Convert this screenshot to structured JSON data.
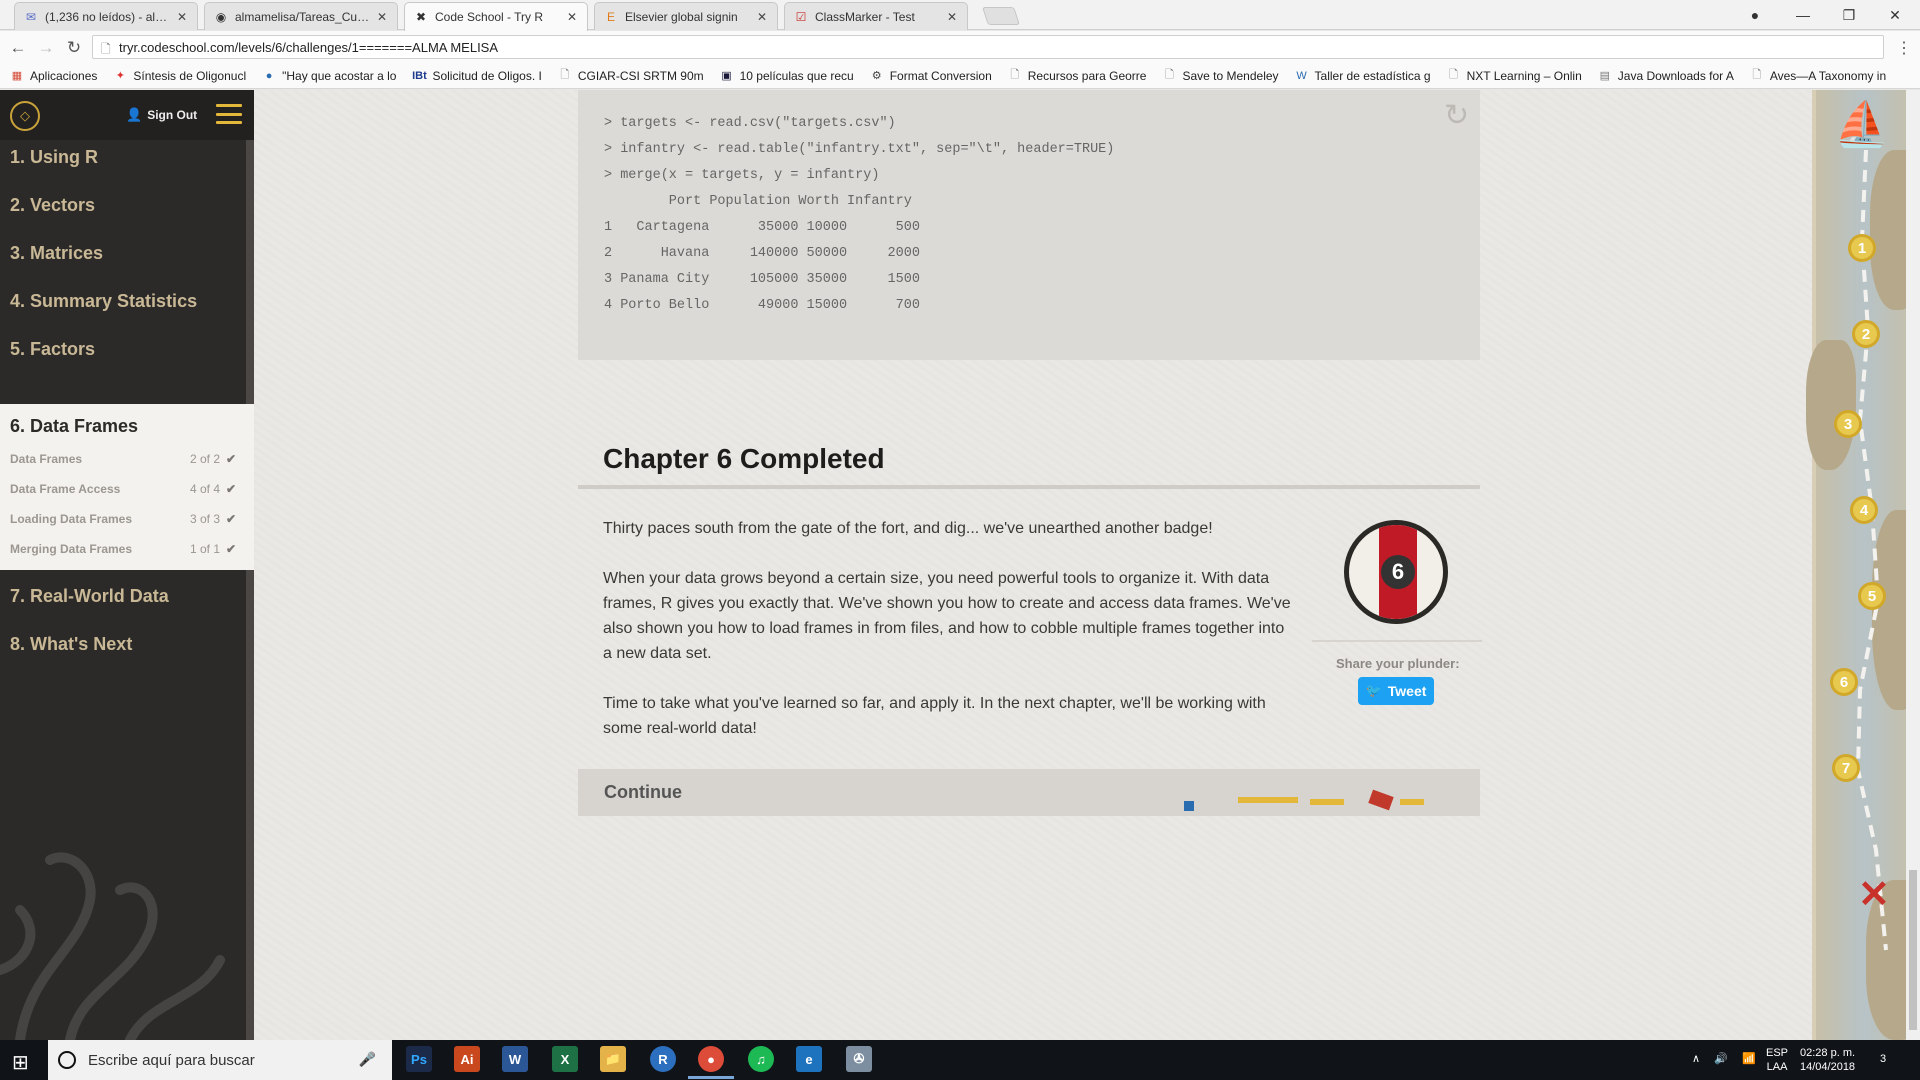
{
  "browser": {
    "tabs": [
      {
        "title": "(1,236 no leídos) - alma",
        "icon": "mail-icon",
        "color": "#5a6ec8"
      },
      {
        "title": "almamelisa/Tareas_Curso",
        "icon": "github-icon",
        "color": "#222222"
      },
      {
        "title": "Code School - Try R",
        "icon": "codeschool-icon",
        "color": "#333333"
      },
      {
        "title": "Elsevier global signin",
        "icon": "elsevier-icon",
        "color": "#e07b1a"
      },
      {
        "title": "ClassMarker - Test",
        "icon": "classmarker-icon",
        "color": "#c8322b"
      }
    ],
    "url": "tryr.codeschool.com/levels/6/challenges/1=======ALMA MELISA",
    "bookmarks": [
      {
        "label": "Aplicaciones",
        "icon": "apps-grid-icon"
      },
      {
        "label": "Síntesis de Oligonucl",
        "icon": "flame-icon"
      },
      {
        "label": "\"Hay que acostar a lo",
        "icon": "globe-icon"
      },
      {
        "label": "Solicitud de Oligos. I",
        "icon": "ibt-icon"
      },
      {
        "label": "CGIAR-CSI SRTM 90m",
        "icon": "page-icon"
      },
      {
        "label": "10 películas que recu",
        "icon": "film-icon"
      },
      {
        "label": "Format Conversion",
        "icon": "gear-icon"
      },
      {
        "label": "Recursos para Georre",
        "icon": "page-icon"
      },
      {
        "label": "Save to Mendeley",
        "icon": "page-icon"
      },
      {
        "label": "Taller de estadística g",
        "icon": "w-icon"
      },
      {
        "label": "NXT Learning – Onlin",
        "icon": "page-icon"
      },
      {
        "label": "Java Downloads for A",
        "icon": "java-icon"
      },
      {
        "label": "Aves—A Taxonomy in",
        "icon": "page-icon"
      }
    ]
  },
  "sidebar": {
    "signout": "Sign Out",
    "chapters": [
      "1. Using R",
      "2. Vectors",
      "3. Matrices",
      "4. Summary Statistics",
      "5. Factors",
      "6. Data Frames",
      "7. Real-World Data",
      "8. What's Next"
    ],
    "lessons": [
      {
        "label": "Data Frames",
        "count": "2 of 2"
      },
      {
        "label": "Data Frame Access",
        "count": "4 of 4"
      },
      {
        "label": "Loading Data Frames",
        "count": "3 of 3"
      },
      {
        "label": "Merging Data Frames",
        "count": "1 of 1"
      }
    ]
  },
  "code": [
    "> targets <- read.csv(\"targets.csv\")",
    "> infantry <- read.table(\"infantry.txt\", sep=\"\\t\", header=TRUE)",
    "> merge(x = targets, y = infantry)",
    "        Port Population Worth Infantry",
    "1   Cartagena      35000 10000      500",
    "2      Havana     140000 50000     2000",
    "3 Panama City     105000 35000     1500",
    "4 Porto Bello      49000 15000      700"
  ],
  "completion": {
    "heading": "Chapter 6 Completed",
    "paragraphs": [
      "Thirty paces south from the gate of the fort, and dig... we've unearthed another badge!",
      "When your data grows beyond a certain size, you need powerful tools to organize it. With data frames, R gives you exactly that. We've shown you how to create and access data frames. We've also shown you how to load frames in from files, and how to cobble multiple frames together into a new data set.",
      "Time to take what you've learned so far, and apply it. In the next chapter, we'll be working with some real-world data!"
    ],
    "badge_number": "6",
    "share_label": "Share your plunder:",
    "tweet_label": "Tweet",
    "continue_label": "Continue"
  },
  "map": {
    "markers": [
      "1",
      "2",
      "3",
      "4",
      "5",
      "6",
      "7"
    ],
    "accent": "#e8c94f"
  },
  "taskbar": {
    "search_placeholder": "Escribe aquí para buscar",
    "apps": [
      {
        "label": "Ps",
        "color": "#1c2a4a"
      },
      {
        "label": "Ai",
        "color": "#c9481e"
      },
      {
        "label": "W",
        "color": "#2b5797"
      },
      {
        "label": "X",
        "color": "#1e7145"
      },
      {
        "label": "📁",
        "color": "#e3b34a"
      },
      {
        "label": "R",
        "color": "#2d6fbf"
      },
      {
        "label": "●",
        "color": "#dd4b39"
      },
      {
        "label": "♫",
        "color": "#1db954"
      },
      {
        "label": "e",
        "color": "#1e73be"
      },
      {
        "label": "✇",
        "color": "#7c8ea0"
      }
    ],
    "lang_top": "ESP",
    "lang_bottom": "LAA",
    "time": "02:28 p. m.",
    "date": "14/04/2018",
    "notifications": "3"
  }
}
